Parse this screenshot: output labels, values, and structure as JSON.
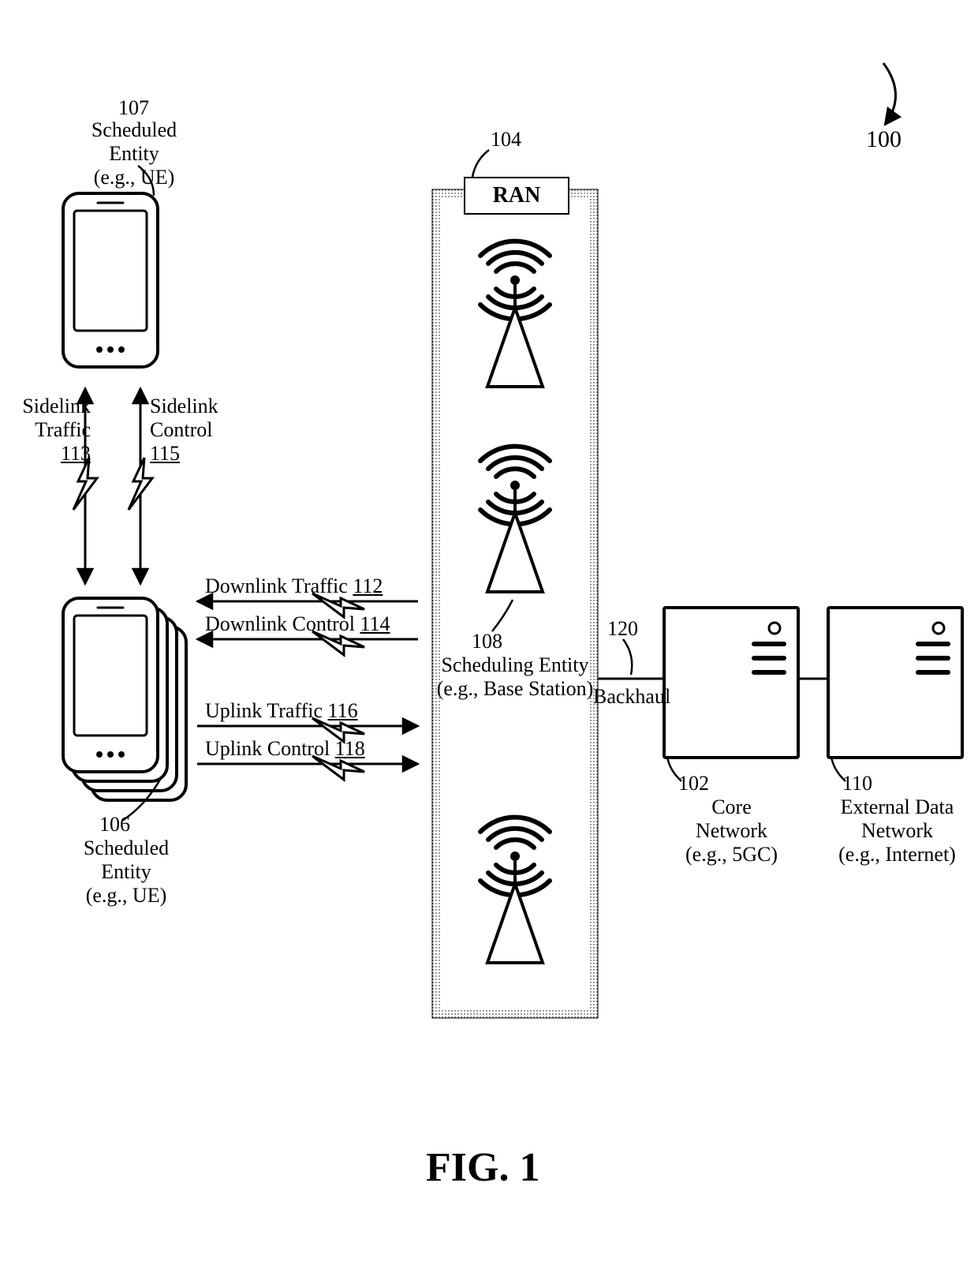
{
  "figure": {
    "title": "FIG. 1",
    "ref": "100"
  },
  "ue107": {
    "ref": "107",
    "line1": "Scheduled",
    "line2": "Entity",
    "line3": "(e.g., UE)"
  },
  "ue106": {
    "ref": "106",
    "line1": "Scheduled",
    "line2": "Entity",
    "line3": "(e.g., UE)"
  },
  "sidelink_traffic": {
    "line1": "Sidelink",
    "line2": "Traffic",
    "ref": "113"
  },
  "sidelink_control": {
    "line1": "Sidelink",
    "line2": "Control",
    "ref": "115"
  },
  "dl_traffic": {
    "text": "Downlink Traffic",
    "ref": "112"
  },
  "dl_control": {
    "text": "Downlink Control",
    "ref": "114"
  },
  "ul_traffic": {
    "text": "Uplink Traffic",
    "ref": "116"
  },
  "ul_control": {
    "text": "Uplink Control",
    "ref": "118"
  },
  "ran": {
    "ref": "104",
    "title": "RAN",
    "sched_ref": "108",
    "sched_line1": "Scheduling Entity",
    "sched_line2": "(e.g., Base Station)"
  },
  "backhaul": {
    "ref": "120",
    "text": "Backhaul"
  },
  "core": {
    "ref": "102",
    "line1": "Core",
    "line2": "Network",
    "line3": "(e.g., 5GC)"
  },
  "extnet": {
    "ref": "110",
    "line1": "External Data",
    "line2": "Network",
    "line3": "(e.g., Internet)"
  }
}
